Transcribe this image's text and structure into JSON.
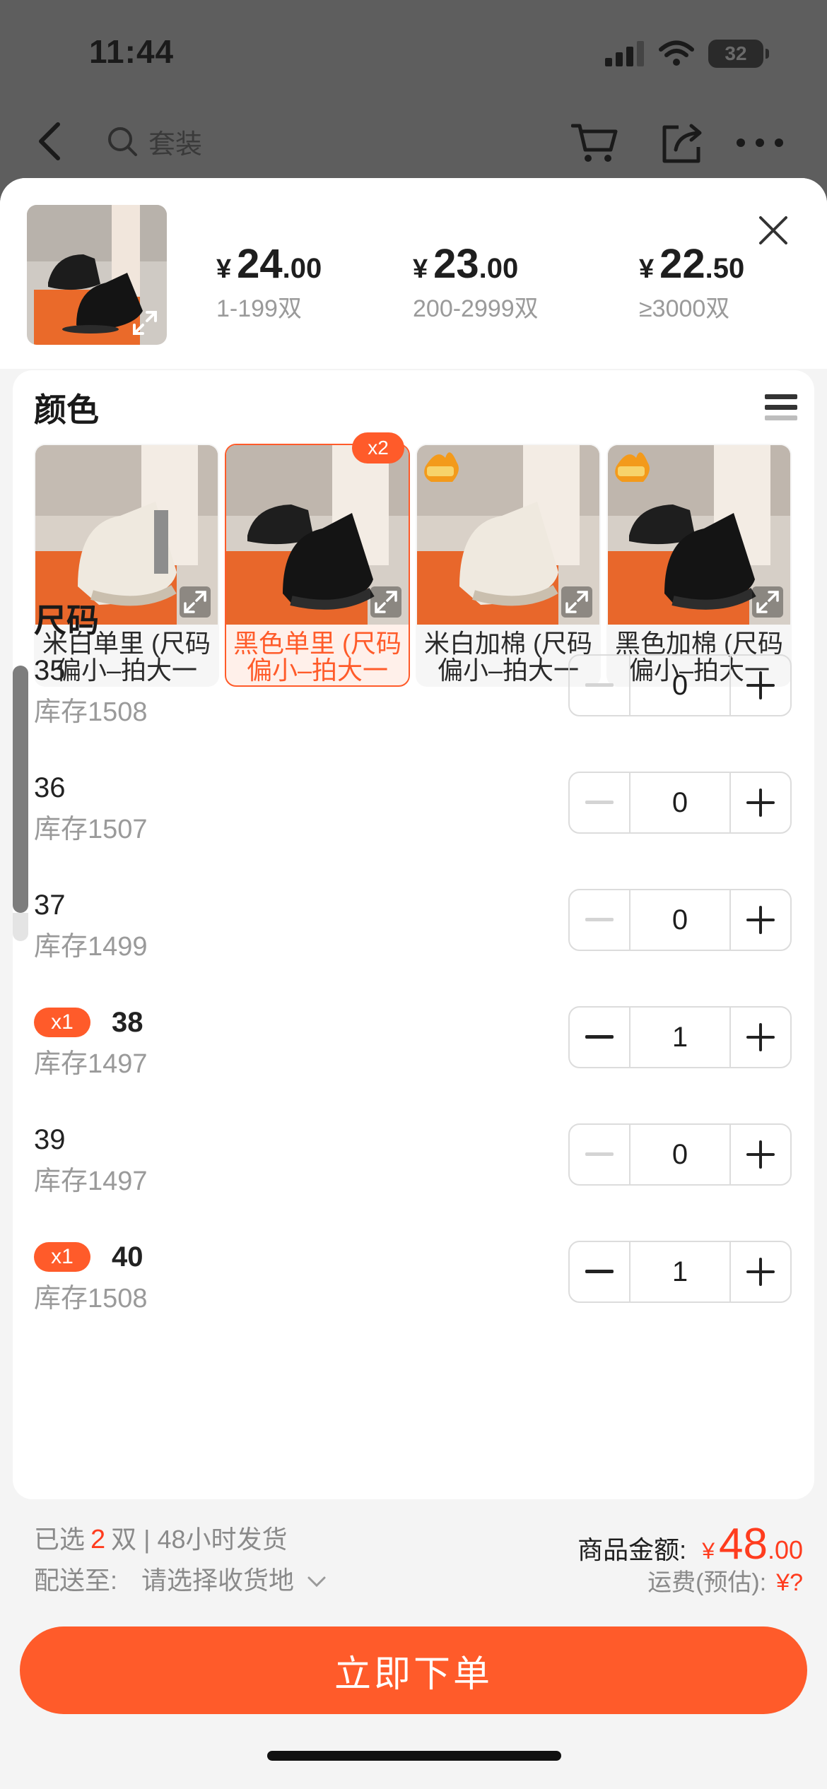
{
  "status_bar": {
    "time": "11:44",
    "battery": "32"
  },
  "top_bar": {
    "search_text": "套装"
  },
  "price_tiers": [
    {
      "symbol": "¥",
      "integer": "24",
      "decimal": ".00",
      "range": "1-199双"
    },
    {
      "symbol": "¥",
      "integer": "23",
      "decimal": ".00",
      "range": "200-2999双"
    },
    {
      "symbol": "¥",
      "integer": "22",
      "decimal": ".50",
      "range": "≥3000双"
    }
  ],
  "color_section": {
    "title": "颜色",
    "selected_badge": "x2",
    "options": [
      {
        "label": "米白单里 (尺码偏小–拍大一码)",
        "selected": false
      },
      {
        "label": "黑色单里 (尺码偏小–拍大一码)",
        "selected": true
      },
      {
        "label": "米白加棉 (尺码偏小–拍大一码)",
        "selected": false
      },
      {
        "label": "黑色加棉 (尺码偏小–拍大一码)",
        "selected": false
      }
    ]
  },
  "size_section": {
    "title": "尺码",
    "rows": [
      {
        "size": "35",
        "stock": "库存1508",
        "qty": "0",
        "badge": ""
      },
      {
        "size": "36",
        "stock": "库存1507",
        "qty": "0",
        "badge": ""
      },
      {
        "size": "37",
        "stock": "库存1499",
        "qty": "0",
        "badge": ""
      },
      {
        "size": "38",
        "stock": "库存1497",
        "qty": "1",
        "badge": "x1"
      },
      {
        "size": "39",
        "stock": "库存1497",
        "qty": "0",
        "badge": ""
      },
      {
        "size": "40",
        "stock": "库存1508",
        "qty": "1",
        "badge": "x1"
      }
    ]
  },
  "footer": {
    "selected_prefix": "已选",
    "selected_count": "2",
    "selected_suffix": "双 | 48小时发货",
    "ship_to_label": "配送至:",
    "ship_to_value": "请选择收货地",
    "total_label": "商品金额:",
    "total_symbol": "¥",
    "total_integer": "48",
    "total_decimal": ".00",
    "freight_label": "运费(预估):",
    "freight_value": "¥?",
    "order_button": "立即下单"
  },
  "colors": {
    "accent": "#ff5b2a",
    "price_red": "#ff3c1e",
    "overlay": "#5e5e5e"
  }
}
